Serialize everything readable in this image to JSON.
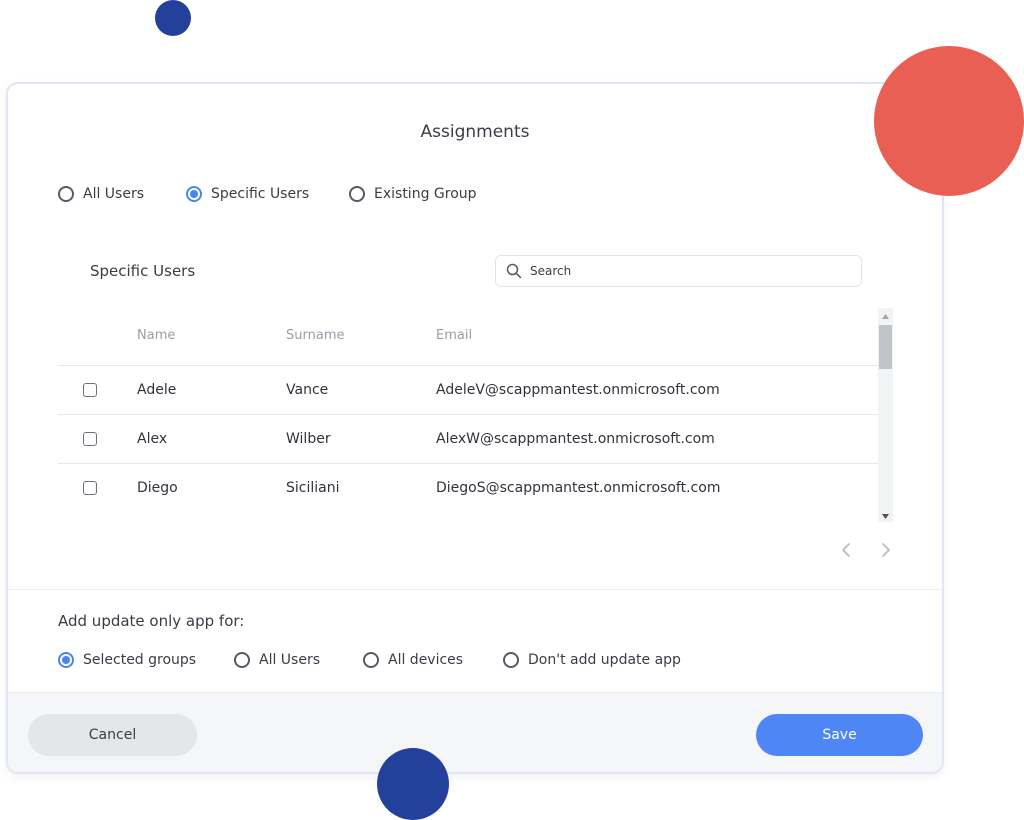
{
  "dialog": {
    "title": "Assignments"
  },
  "assignment_options": [
    {
      "label": "All Users",
      "checked": false
    },
    {
      "label": "Specific Users",
      "checked": true
    },
    {
      "label": "Existing Group",
      "checked": false
    }
  ],
  "specific_users": {
    "title": "Specific Users",
    "search_placeholder": "Search",
    "columns": [
      "Name",
      "Surname",
      "Email"
    ],
    "rows": [
      {
        "name": "Adele",
        "surname": "Vance",
        "email": "AdeleV@scappmantest.onmicrosoft.com"
      },
      {
        "name": "Alex",
        "surname": "Wilber",
        "email": "AlexW@scappmantest.onmicrosoft.com"
      },
      {
        "name": "Diego",
        "surname": "Siciliani",
        "email": "DiegoS@scappmantest.onmicrosoft.com"
      }
    ]
  },
  "update_app": {
    "label": "Add update only app for:",
    "options": [
      {
        "label": "Selected groups",
        "checked": true
      },
      {
        "label": "All Users",
        "checked": false
      },
      {
        "label": "All devices",
        "checked": false
      },
      {
        "label": "Don't add update app",
        "checked": false
      }
    ]
  },
  "footer": {
    "cancel_label": "Cancel",
    "save_label": "Save"
  },
  "icons": {
    "search": "search-icon",
    "prev": "chevron-left-icon",
    "next": "chevron-right-icon"
  },
  "colors": {
    "accent": "#4f86f5",
    "decor_blue": "#23409a",
    "decor_red": "#ea5f53"
  }
}
